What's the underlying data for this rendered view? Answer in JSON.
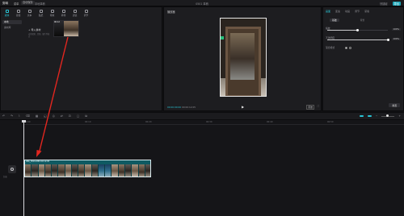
{
  "titlebar": {
    "logo": "剪映",
    "menu": "菜单",
    "chip": "自动保存",
    "draft": "本地草稿",
    "title": "0501 草稿",
    "right": [
      "快捷键",
      "导出"
    ]
  },
  "media": {
    "tools": [
      {
        "label": "媒体",
        "icon": "media-icon"
      },
      {
        "label": "音频",
        "icon": "audio-icon"
      },
      {
        "label": "文本",
        "icon": "text-icon"
      },
      {
        "label": "贴纸",
        "icon": "sticker-icon"
      },
      {
        "label": "特效",
        "icon": "effects-icon"
      },
      {
        "label": "转场",
        "icon": "transition-icon"
      },
      {
        "label": "滤镜",
        "icon": "filter-icon"
      },
      {
        "label": "调节",
        "icon": "adjust-icon"
      }
    ],
    "side": [
      "本地",
      "素材库"
    ],
    "import_label": "+ 导入素材",
    "import_hint": "支持视频、音频、图片等格式",
    "thumb_duration": "00:12"
  },
  "player": {
    "header": "播放器",
    "time_current": "00:00:00:00",
    "time_total": "00:00:12:05",
    "ratio": "原始",
    "play_icon": "play-icon",
    "fullscreen_icon": "fullscreen-icon"
  },
  "inspector": {
    "tabs": [
      "画面",
      "变速",
      "动画",
      "调节",
      "蒙版"
    ],
    "active_tab": 0,
    "subtabs": [
      "基础",
      "背景"
    ],
    "rows": [
      {
        "label": "缩放",
        "value": "100%",
        "level": 0.5
      },
      {
        "label": "不透明度",
        "value": "100%",
        "level": 1.0
      },
      {
        "label": "混合模式",
        "value": "正常",
        "level": null
      }
    ],
    "reset": "重置"
  },
  "timeline": {
    "tools": [
      "↶",
      "↷",
      "⌇",
      "⌫",
      "▦",
      "◱",
      "◎",
      "⇄",
      "⊡",
      "▢",
      "⧉"
    ],
    "ruler": [
      "00:00",
      "00:10",
      "00:20",
      "00:30",
      "00:40",
      "00:50"
    ],
    "track_label": "封面",
    "clip_label": "IMG_0501.MP4 00:12:05",
    "accent": "#29c6d6"
  }
}
